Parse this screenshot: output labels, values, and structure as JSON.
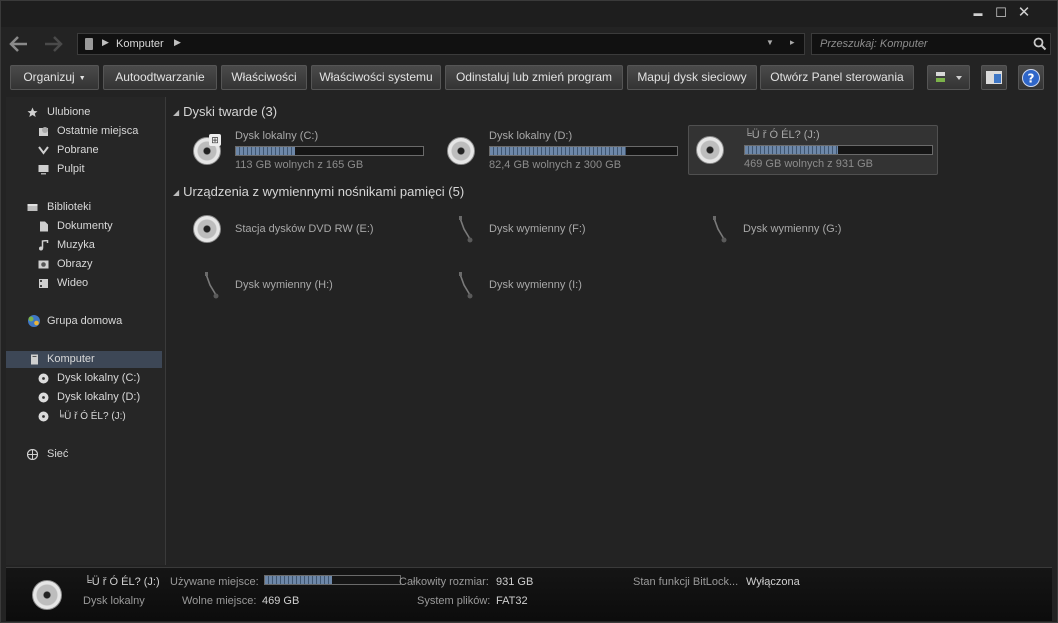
{
  "window": {
    "controls": {
      "minimize": "▬",
      "maximize": "☐",
      "close": "✕"
    }
  },
  "nav": {
    "back_icon": "back-arrow-icon",
    "forward_icon": "forward-arrow-icon",
    "address": "Komputer",
    "search_placeholder": "Przeszukaj: Komputer"
  },
  "toolbar": {
    "organize": "Organizuj",
    "autoplay": "Autoodtwarzanie",
    "properties": "Właściwości",
    "system_properties": "Właściwości systemu",
    "uninstall": "Odinstaluj lub zmień program",
    "map_drive": "Mapuj dysk sieciowy",
    "control_panel": "Otwórz Panel sterowania"
  },
  "sidebar": {
    "favorites": "Ulubione",
    "recent": "Ostatnie miejsca",
    "downloads": "Pobrane",
    "desktop": "Pulpit",
    "libraries": "Biblioteki",
    "documents": "Dokumenty",
    "music": "Muzyka",
    "pictures": "Obrazy",
    "videos": "Wideo",
    "homegroup": "Grupa domowa",
    "computer": "Komputer",
    "drive_c": "Dysk lokalny (C:)",
    "drive_d": "Dysk lokalny (D:)",
    "drive_j": "╘Ü    ř Ó ÉL? (J:)",
    "network": "Sieć"
  },
  "content": {
    "hdd_header": "Dyski twarde (3)",
    "removable_header": "Urządzenia z wymiennymi nośnikami pamięci (5)",
    "drives": [
      {
        "name": "Dysk lokalny (C:)",
        "free": "113 GB wolnych z 165 GB",
        "used_fraction": 0.315
      },
      {
        "name": "Dysk lokalny (D:)",
        "free": "82,4 GB wolnych z 300 GB",
        "used_fraction": 0.725
      },
      {
        "name": "╘Ü    ř Ó ÉL? (J:)",
        "free": "469 GB wolnych z 931 GB",
        "used_fraction": 0.496
      }
    ],
    "removable": [
      {
        "name": "Stacja dysków DVD RW (E:)"
      },
      {
        "name": "Dysk wymienny (F:)"
      },
      {
        "name": "Dysk wymienny (G:)"
      },
      {
        "name": "Dysk wymienny (H:)"
      },
      {
        "name": "Dysk wymienny (I:)"
      }
    ]
  },
  "details": {
    "name": "╘Ü    ř Ó ÉL? (J:)",
    "type": "Dysk lokalny",
    "used_label": "Używane miejsce:",
    "used_fraction": 0.496,
    "free_label": "Wolne miejsce:",
    "free_value": "469 GB",
    "total_label": "Całkowity rozmiar:",
    "total_value": "931 GB",
    "fs_label": "System plików:",
    "fs_value": "FAT32",
    "bitlocker_label": "Stan funkcji BitLock...",
    "bitlocker_value": "Wyłączona"
  },
  "colors": {
    "bar_fill": "#6d87a8",
    "selection": "#3d4756",
    "background": "#232323"
  }
}
